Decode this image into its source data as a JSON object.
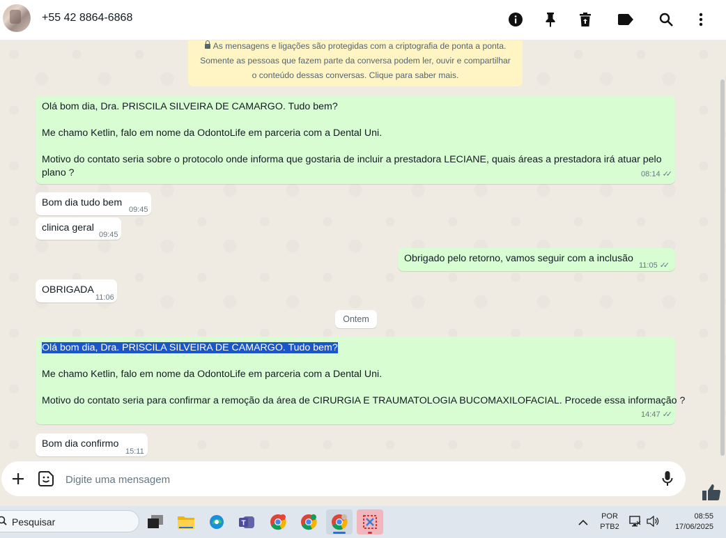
{
  "header": {
    "contact_name": "+55 42 8864-6868",
    "icons": [
      "info-icon",
      "pin-icon",
      "delete-icon",
      "label-icon",
      "search-icon",
      "more-icon"
    ]
  },
  "encryption_notice": {
    "line1": "As mensagens e ligações são protegidas com a criptografia de ponta a ponta.",
    "line2": "Somente as pessoas que fazem parte da conversa podem ler, ouvir e compartilhar",
    "line3": "o conteúdo dessas conversas. Clique para saber mais."
  },
  "messages": [
    {
      "direction": "out",
      "lines": [
        "Olá bom dia, Dra. PRISCILA SILVEIRA DE CAMARGO. Tudo bem?",
        "",
        "Me chamo Ketlin, falo em nome da OdontoLife em parceria com a Dental Uni.",
        "",
        "Motivo do contato seria sobre o protocolo onde informa que gostaria de incluir a prestadora LECIANE, quais áreas a prestadora irá atuar pelo",
        "plano ?"
      ],
      "time": "08:14",
      "status": "read"
    },
    {
      "direction": "in",
      "text": "Bom dia tudo bem",
      "time": "09:45"
    },
    {
      "direction": "in",
      "text": "clinica geral",
      "time": "09:45"
    },
    {
      "direction": "out",
      "text": "Obrigado pelo retorno, vamos seguir com a inclusão",
      "time": "11:05",
      "status": "read"
    },
    {
      "direction": "in",
      "text": "OBRIGADA",
      "time": "11:06"
    },
    {
      "direction": "out",
      "lines": [
        "Olá bom dia, Dra. PRISCILA SILVEIRA DE CAMARGO. Tudo bem?",
        "",
        "Me chamo Ketlin, falo em nome da OdontoLife em parceria com a Dental Uni.",
        "",
        "Motivo do contato seria para confirmar a remoção da área de CIRURGIA E TRAUMATOLOGIA BUCOMAXILOFACIAL. Procede essa informação ?"
      ],
      "time": "14:47",
      "status": "read",
      "selected_line": 0
    },
    {
      "direction": "in",
      "text": "Bom dia confirmo",
      "time": "15:11"
    }
  ],
  "date_separator": "Ontem",
  "composer": {
    "placeholder": "Digite uma mensagem",
    "icons": [
      "plus-icon",
      "sticker-icon",
      "mic-icon"
    ]
  },
  "taskbar": {
    "search_label": "Pesquisar",
    "language": "POR",
    "keyboard": "PTB2",
    "time": "08:55",
    "date": "17/06/2025",
    "apps": [
      "task-view-icon",
      "file-explorer-icon",
      "edge-icon",
      "teams-icon",
      "chrome-icon",
      "chrome-profile-icon",
      "chrome-active-icon",
      "snipping-tool-icon"
    ]
  },
  "colors": {
    "outgoing_bubble": "#d9fdd3",
    "incoming_bubble": "#ffffff",
    "chat_background": "#efeae2",
    "notice_background": "#fff5c4",
    "selection": "#1a56c8"
  }
}
